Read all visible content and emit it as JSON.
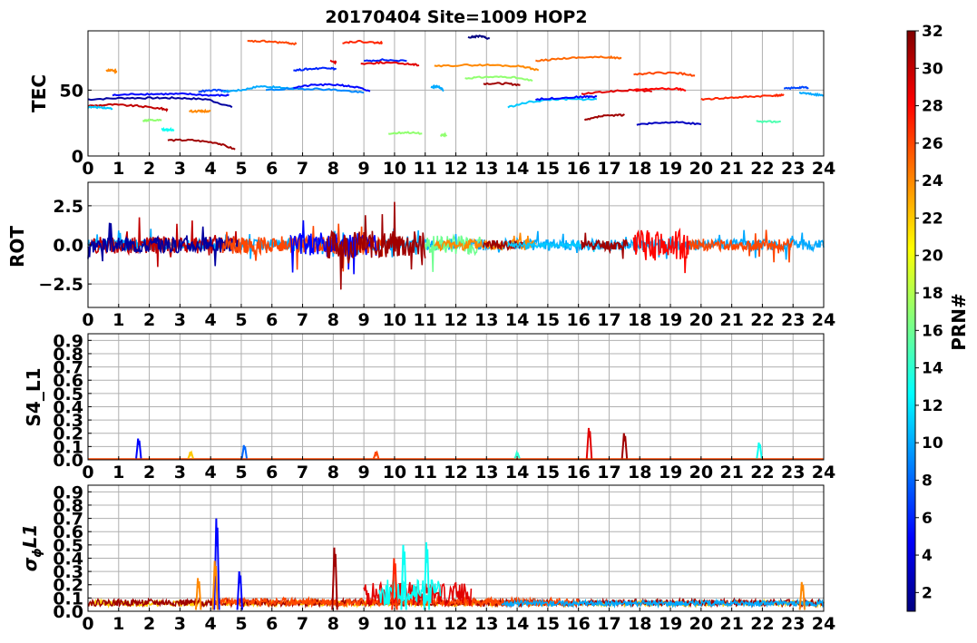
{
  "chart_data": [
    {
      "type": "line",
      "id": "tec",
      "title": "20170404 Site=1009 HOP2",
      "ylabel": "TEC",
      "xlim": [
        0,
        24
      ],
      "ylim": [
        0,
        95
      ],
      "x_ticks": [
        0,
        1,
        2,
        3,
        4,
        5,
        6,
        7,
        8,
        9,
        10,
        11,
        12,
        13,
        14,
        15,
        16,
        17,
        18,
        19,
        20,
        21,
        22,
        23,
        24
      ],
      "y_ticks": [
        0,
        50
      ],
      "grid": true,
      "segments": [
        {
          "prn": 2,
          "x": [
            0,
            1.2,
            2.2,
            3.0,
            3.9,
            4.7
          ],
          "y": [
            43,
            44,
            44,
            44,
            43,
            37
          ]
        },
        {
          "prn": 5,
          "x": [
            0.8,
            1.6,
            2.4,
            3.2,
            4.0,
            4.6
          ],
          "y": [
            46,
            47,
            47,
            47,
            46,
            46
          ]
        },
        {
          "prn": 30,
          "x": [
            0,
            0.8,
            1.6,
            2.4,
            2.6
          ],
          "y": [
            38,
            39,
            38,
            36,
            35
          ]
        },
        {
          "prn": 11,
          "x": [
            0,
            0.4,
            0.8
          ],
          "y": [
            37,
            37,
            36
          ]
        },
        {
          "prn": 24,
          "x": [
            0.6,
            0.8,
            0.95
          ],
          "y": [
            65,
            65,
            64
          ]
        },
        {
          "prn": 17,
          "x": [
            1.8,
            2.0,
            2.4
          ],
          "y": [
            27,
            27,
            27
          ]
        },
        {
          "prn": 13,
          "x": [
            2.4,
            2.6,
            2.8
          ],
          "y": [
            20,
            20,
            20
          ]
        },
        {
          "prn": 31,
          "x": [
            2.6,
            3.4,
            4.2,
            4.8
          ],
          "y": [
            12,
            12,
            10,
            5
          ]
        },
        {
          "prn": 24,
          "x": [
            3.3,
            3.7,
            4.0
          ],
          "y": [
            34,
            34,
            34
          ]
        },
        {
          "prn": 7,
          "x": [
            3.6,
            4.2,
            4.6
          ],
          "y": [
            49,
            50,
            49
          ]
        },
        {
          "prn": 10,
          "x": [
            4.4,
            5.0,
            5.6,
            6.2,
            6.8
          ],
          "y": [
            49,
            50,
            53,
            52,
            51
          ]
        },
        {
          "prn": 26,
          "x": [
            5.2,
            5.8,
            6.4,
            6.8
          ],
          "y": [
            87,
            87,
            86,
            85
          ]
        },
        {
          "prn": 9,
          "x": [
            5.8,
            6.6,
            7.4,
            8.2,
            9.0
          ],
          "y": [
            50,
            51,
            51,
            50,
            48
          ]
        },
        {
          "prn": 6,
          "x": [
            6.7,
            7.2,
            7.8,
            8.1
          ],
          "y": [
            65,
            66,
            67,
            66
          ]
        },
        {
          "prn": 5,
          "x": [
            6.7,
            7.4,
            8.2,
            8.8,
            9.2
          ],
          "y": [
            52,
            54,
            54,
            52,
            49
          ]
        },
        {
          "prn": 27,
          "x": [
            8.3,
            8.8,
            9.4,
            9.6
          ],
          "y": [
            86,
            87,
            86,
            86
          ]
        },
        {
          "prn": 29,
          "x": [
            7.9,
            8.1
          ],
          "y": [
            72,
            71
          ]
        },
        {
          "prn": 6,
          "x": [
            9.0,
            9.6,
            10.4
          ],
          "y": [
            72,
            73,
            72
          ]
        },
        {
          "prn": 29,
          "x": [
            8.9,
            9.6,
            10.4,
            10.8
          ],
          "y": [
            70,
            71,
            70,
            69
          ]
        },
        {
          "prn": 17,
          "x": [
            9.8,
            10.4,
            10.9
          ],
          "y": [
            17,
            18,
            17
          ]
        },
        {
          "prn": 17,
          "x": [
            11.5,
            11.7
          ],
          "y": [
            16,
            16
          ]
        },
        {
          "prn": 10,
          "x": [
            11.2,
            11.4,
            11.6
          ],
          "y": [
            52,
            53,
            50
          ]
        },
        {
          "prn": 24,
          "x": [
            11.3,
            12.2,
            13.2,
            14.2,
            14.7
          ],
          "y": [
            68,
            69,
            69,
            68,
            65
          ]
        },
        {
          "prn": 1,
          "x": [
            12.4,
            12.8,
            13.1
          ],
          "y": [
            90,
            91,
            89
          ]
        },
        {
          "prn": 17,
          "x": [
            12.3,
            13.0,
            13.8,
            14.5
          ],
          "y": [
            59,
            60,
            60,
            57
          ]
        },
        {
          "prn": 31,
          "x": [
            12.9,
            13.6,
            14.1
          ],
          "y": [
            55,
            55,
            54
          ]
        },
        {
          "prn": 11,
          "x": [
            13.7,
            14.4,
            15.2,
            16.0,
            16.6
          ],
          "y": [
            37,
            41,
            43,
            43,
            43
          ]
        },
        {
          "prn": 5,
          "x": [
            14.6,
            15.4,
            16.2,
            16.6
          ],
          "y": [
            43,
            44,
            45,
            45
          ]
        },
        {
          "prn": 25,
          "x": [
            14.6,
            15.4,
            16.2,
            17.0,
            17.4
          ],
          "y": [
            72,
            74,
            75,
            75,
            74
          ]
        },
        {
          "prn": 29,
          "x": [
            16.1,
            17.0,
            17.8,
            18.4
          ],
          "y": [
            47,
            49,
            50,
            49
          ]
        },
        {
          "prn": 31,
          "x": [
            16.2,
            16.7,
            17.2,
            17.5
          ],
          "y": [
            27,
            30,
            31,
            31
          ]
        },
        {
          "prn": 28,
          "x": [
            17.8,
            18.4,
            19.2,
            19.5
          ],
          "y": [
            50,
            51,
            51,
            50
          ]
        },
        {
          "prn": 26,
          "x": [
            17.8,
            18.5,
            19.2,
            19.8
          ],
          "y": [
            62,
            63,
            63,
            61
          ]
        },
        {
          "prn": 3,
          "x": [
            17.9,
            18.5,
            19.2,
            20.0
          ],
          "y": [
            24,
            25,
            26,
            24
          ]
        },
        {
          "prn": 27,
          "x": [
            20.0,
            20.8,
            21.6,
            22.4,
            22.7
          ],
          "y": [
            43,
            44,
            45,
            46,
            46
          ]
        },
        {
          "prn": 15,
          "x": [
            21.8,
            22.2,
            22.6
          ],
          "y": [
            26,
            26,
            26
          ]
        },
        {
          "prn": 7,
          "x": [
            22.7,
            23.2,
            23.5
          ],
          "y": [
            51,
            52,
            52
          ]
        },
        {
          "prn": 10,
          "x": [
            23.2,
            23.6,
            24.0
          ],
          "y": [
            48,
            47,
            46
          ]
        }
      ]
    },
    {
      "type": "line",
      "id": "rot",
      "ylabel": "ROT",
      "xlim": [
        0,
        24
      ],
      "ylim": [
        -4,
        4
      ],
      "x_ticks": [
        0,
        1,
        2,
        3,
        4,
        5,
        6,
        7,
        8,
        9,
        10,
        11,
        12,
        13,
        14,
        15,
        16,
        17,
        18,
        19,
        20,
        21,
        22,
        23,
        24
      ],
      "y_ticks": [
        -2.5,
        0.0,
        2.5
      ],
      "grid": true,
      "series": [
        {
          "prn": 10,
          "x": [
            0,
            24
          ],
          "amp": 0.35,
          "seed": 1
        },
        {
          "prn": 30,
          "x": [
            0,
            4.9
          ],
          "amp": 0.55,
          "seed": 2
        },
        {
          "prn": 2,
          "x": [
            0,
            4.9
          ],
          "amp": 0.5,
          "seed": 3
        },
        {
          "prn": 26,
          "x": [
            4.4,
            9.6
          ],
          "amp": 0.55,
          "seed": 4
        },
        {
          "prn": 5,
          "x": [
            6.6,
            9.4
          ],
          "amp": 0.8,
          "seed": 5
        },
        {
          "prn": 31,
          "x": [
            7.8,
            11.0
          ],
          "amp": 0.9,
          "seed": 6
        },
        {
          "prn": 16,
          "x": [
            11.0,
            12.8
          ],
          "amp": 0.6,
          "seed": 7
        },
        {
          "prn": 24,
          "x": [
            11.3,
            14.6
          ],
          "amp": 0.35,
          "seed": 8
        },
        {
          "prn": 31,
          "x": [
            12.9,
            14.2
          ],
          "amp": 0.3,
          "seed": 9
        },
        {
          "prn": 11,
          "x": [
            13.7,
            16.6
          ],
          "amp": 0.15,
          "seed": 10
        },
        {
          "prn": 31,
          "x": [
            16.1,
            17.6
          ],
          "amp": 0.35,
          "seed": 11
        },
        {
          "prn": 28,
          "x": [
            17.8,
            19.6
          ],
          "amp": 1.0,
          "seed": 12
        },
        {
          "prn": 26,
          "x": [
            19.6,
            23.0
          ],
          "amp": 0.35,
          "seed": 13
        }
      ]
    },
    {
      "type": "line",
      "id": "s4",
      "ylabel": "S4_L1",
      "xlim": [
        0,
        24
      ],
      "ylim": [
        0,
        0.95
      ],
      "x_ticks": [
        0,
        1,
        2,
        3,
        4,
        5,
        6,
        7,
        8,
        9,
        10,
        11,
        12,
        13,
        14,
        15,
        16,
        17,
        18,
        19,
        20,
        21,
        22,
        23,
        24
      ],
      "y_ticks": [
        0.0,
        0.1,
        0.2,
        0.3,
        0.4,
        0.5,
        0.6,
        0.7,
        0.8,
        0.9
      ],
      "grid": true,
      "spikes": [
        {
          "prn": 5,
          "x": 1.65,
          "y": 0.16
        },
        {
          "prn": 22,
          "x": 3.35,
          "y": 0.06
        },
        {
          "prn": 8,
          "x": 5.1,
          "y": 0.11
        },
        {
          "prn": 26,
          "x": 9.4,
          "y": 0.06
        },
        {
          "prn": 14,
          "x": 14.0,
          "y": 0.05
        },
        {
          "prn": 29,
          "x": 16.35,
          "y": 0.24
        },
        {
          "prn": 31,
          "x": 17.5,
          "y": 0.2
        },
        {
          "prn": 13,
          "x": 21.9,
          "y": 0.13
        }
      ]
    },
    {
      "type": "line",
      "id": "sigma",
      "ylabel": "σ_φ L1",
      "xlim": [
        0,
        24
      ],
      "ylim": [
        0,
        0.95
      ],
      "x_ticks": [
        0,
        1,
        2,
        3,
        4,
        5,
        6,
        7,
        8,
        9,
        10,
        11,
        12,
        13,
        14,
        15,
        16,
        17,
        18,
        19,
        20,
        21,
        22,
        23,
        24
      ],
      "y_ticks": [
        0.0,
        0.1,
        0.2,
        0.3,
        0.4,
        0.5,
        0.6,
        0.7,
        0.8,
        0.9
      ],
      "grid": true,
      "spikes": [
        {
          "prn": 5,
          "x": 4.2,
          "y": 0.7
        },
        {
          "prn": 24,
          "x": 3.6,
          "y": 0.25
        },
        {
          "prn": 24,
          "x": 4.15,
          "y": 0.38
        },
        {
          "prn": 5,
          "x": 4.95,
          "y": 0.3
        },
        {
          "prn": 31,
          "x": 8.05,
          "y": 0.48
        },
        {
          "prn": 13,
          "x": 10.3,
          "y": 0.5
        },
        {
          "prn": 13,
          "x": 11.05,
          "y": 0.52
        },
        {
          "prn": 24,
          "x": 23.3,
          "y": 0.22
        },
        {
          "prn": 27,
          "x": 10.0,
          "y": 0.4
        }
      ],
      "series": [
        {
          "prn": 22,
          "x": [
            0,
            24
          ],
          "amp": 0.04,
          "seed": 21
        },
        {
          "prn": 31,
          "x": [
            0,
            24
          ],
          "amp": 0.05,
          "seed": 22
        },
        {
          "prn": 26,
          "x": [
            4.0,
            16.0
          ],
          "amp": 0.06,
          "seed": 23
        },
        {
          "prn": 29,
          "x": [
            9.0,
            12.5
          ],
          "amp": 0.18,
          "seed": 24
        },
        {
          "prn": 13,
          "x": [
            9.5,
            11.5
          ],
          "amp": 0.2,
          "seed": 25
        },
        {
          "prn": 10,
          "x": [
            13.5,
            24
          ],
          "amp": 0.04,
          "seed": 26
        }
      ]
    }
  ],
  "colorbar": {
    "label": "PRN#",
    "min": 1,
    "max": 32,
    "ticks": [
      2,
      4,
      6,
      8,
      10,
      12,
      14,
      16,
      18,
      20,
      22,
      24,
      26,
      28,
      30,
      32
    ],
    "colormap": "jet"
  }
}
